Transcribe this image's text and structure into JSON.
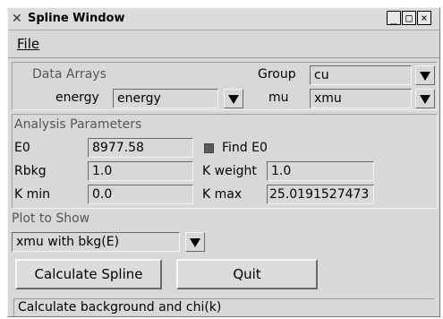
{
  "window": {
    "title": "Spline Window",
    "minimize_glyph": "_",
    "maximize_glyph": "□",
    "close_glyph": "×"
  },
  "menu": {
    "file": "File"
  },
  "data_arrays": {
    "heading": "Data Arrays",
    "group_label": "Group",
    "group_value": "cu",
    "energy_label": "energy",
    "energy_value": "energy",
    "mu_label": "mu",
    "mu_value": "xmu"
  },
  "analysis": {
    "heading": "Analysis Parameters",
    "e0_label": "E0",
    "e0_value": "8977.58",
    "find_e0_label": "Find E0",
    "find_e0_checked": true,
    "rbkg_label": "Rbkg",
    "rbkg_value": "1.0",
    "kweight_label": "K weight",
    "kweight_value": "1.0",
    "kmin_label": "K min",
    "kmin_value": "0.0",
    "kmax_label": "K max",
    "kmax_value": "25.0191527473"
  },
  "plot": {
    "heading": "Plot to Show",
    "selected": "xmu with bkg(E)"
  },
  "buttons": {
    "calculate": "Calculate Spline",
    "quit": "Quit"
  },
  "status": "Calculate background and chi(k)"
}
